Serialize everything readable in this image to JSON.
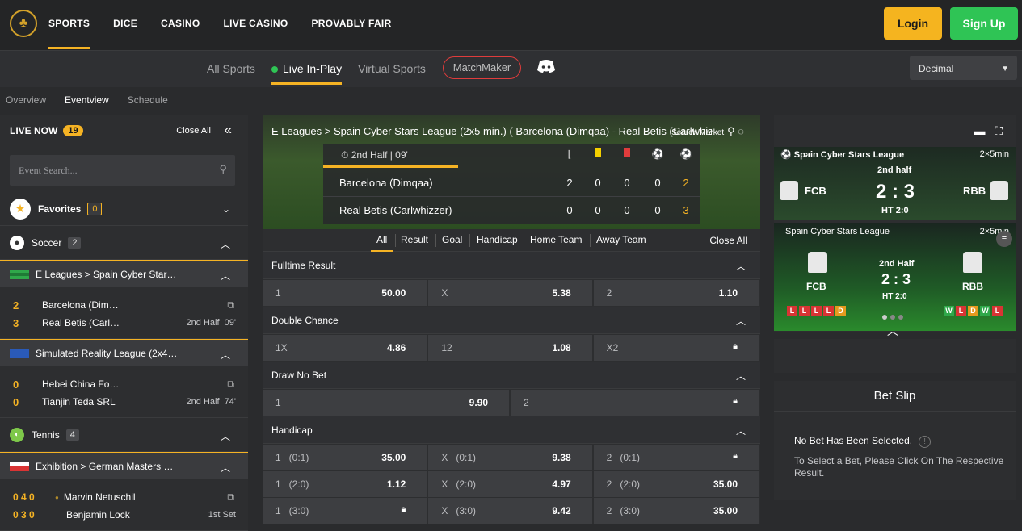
{
  "nav": {
    "items": [
      "SPORTS",
      "DICE",
      "CASINO",
      "LIVE CASINO",
      "PROVABLY FAIR"
    ],
    "login": "Login",
    "signup": "Sign Up"
  },
  "subnav": {
    "items": [
      "All Sports",
      "Live In-Play",
      "Virtual Sports"
    ],
    "matchmaker": "MatchMaker",
    "odds_format": "Decimal"
  },
  "viewtabs": [
    "Overview",
    "Eventview",
    "Schedule"
  ],
  "sidebar": {
    "live_now": "LIVE NOW",
    "live_count": "19",
    "close_all": "Close All",
    "search_placeholder": "Event Search...",
    "favorites": {
      "label": "Favorites",
      "count": "0"
    },
    "soccer": {
      "label": "Soccer",
      "count": "2"
    },
    "league1": "E Leagues > Spain Cyber Star…",
    "match1": {
      "s1": "2",
      "t1": "Barcelona (Dim…",
      "s2": "3",
      "t2": "Real Betis (Carl…",
      "half": "2nd Half",
      "min": "09'"
    },
    "league2": "Simulated Reality League (2x4…",
    "match2": {
      "s1": "0",
      "t1": "Hebei China Fo…",
      "s2": "0",
      "t2": "Tianjin Teda SRL",
      "half": "2nd Half",
      "min": "74'"
    },
    "tennis": {
      "label": "Tennis",
      "count": "4"
    },
    "league3": "Exhibition > German Masters …",
    "match3": {
      "s1": "0 4 0",
      "t1": "Marvin Netuschil",
      "s2": "0 3 0",
      "t2": "Benjamin Lock",
      "set": "1st Set"
    }
  },
  "event": {
    "title": "E Leagues > Spain Cyber Stars League (2x5 min.) ( Barcelona (Dimqaa) - Real Betis (Carlwhizzer) )",
    "search_market": "Search Market",
    "half": "2nd Half | 09'",
    "home": {
      "name": "Barcelona (Dimqaa)",
      "stats": [
        "2",
        "0",
        "0",
        "0"
      ],
      "score": "2"
    },
    "away": {
      "name": "Real Betis (Carlwhizzer)",
      "stats": [
        "0",
        "0",
        "0",
        "0"
      ],
      "score": "3"
    }
  },
  "market_tabs": [
    "All",
    "Result",
    "Goal",
    "Handicap",
    "Home Team",
    "Away Team"
  ],
  "close_all_markets": "Close All",
  "markets": {
    "fulltime": {
      "title": "Fulltime Result",
      "o": [
        {
          "l": "1",
          "v": "50.00"
        },
        {
          "l": "X",
          "v": "5.38"
        },
        {
          "l": "2",
          "v": "1.10"
        }
      ]
    },
    "double": {
      "title": "Double Chance",
      "o": [
        {
          "l": "1X",
          "v": "4.86"
        },
        {
          "l": "12",
          "v": "1.08"
        },
        {
          "l": "X2",
          "v": ""
        }
      ]
    },
    "dnb": {
      "title": "Draw No Bet",
      "o": [
        {
          "l": "1",
          "v": "9.90"
        },
        {
          "l": "2",
          "v": ""
        }
      ]
    },
    "handicap": {
      "title": "Handicap",
      "rows": [
        [
          {
            "l": "1   (0:1)",
            "v": "35.00"
          },
          {
            "l": "X   (0:1)",
            "v": "9.38"
          },
          {
            "l": "2   (0:1)",
            "v": ""
          }
        ],
        [
          {
            "l": "1   (2:0)",
            "v": "1.12"
          },
          {
            "l": "X   (2:0)",
            "v": "4.97"
          },
          {
            "l": "2   (2:0)",
            "v": "35.00"
          }
        ],
        [
          {
            "l": "1   (3:0)",
            "v": ""
          },
          {
            "l": "X   (3:0)",
            "v": "9.42"
          },
          {
            "l": "2   (3:0)",
            "v": "35.00"
          }
        ]
      ]
    }
  },
  "live_widget": {
    "league": "Spain Cyber Stars League",
    "duration": "2×5min",
    "half": "2nd half",
    "home": "FCB",
    "away": "RBB",
    "score": "2 : 3",
    "ht": "HT 2:0",
    "league2": "Spain Cyber Stars League",
    "duration2": "2×5min",
    "half2": "2nd Half",
    "score2": "2 : 3",
    "ht2": "HT 2:0",
    "form_home": [
      "L",
      "L",
      "L",
      "L",
      "D"
    ],
    "form_away": [
      "W",
      "L",
      "D",
      "W",
      "L"
    ]
  },
  "betslip": {
    "title": "Bet Slip",
    "empty": "No Bet Has Been Selected.",
    "hint": "To Select a Bet, Please Click On The Respective Result."
  }
}
